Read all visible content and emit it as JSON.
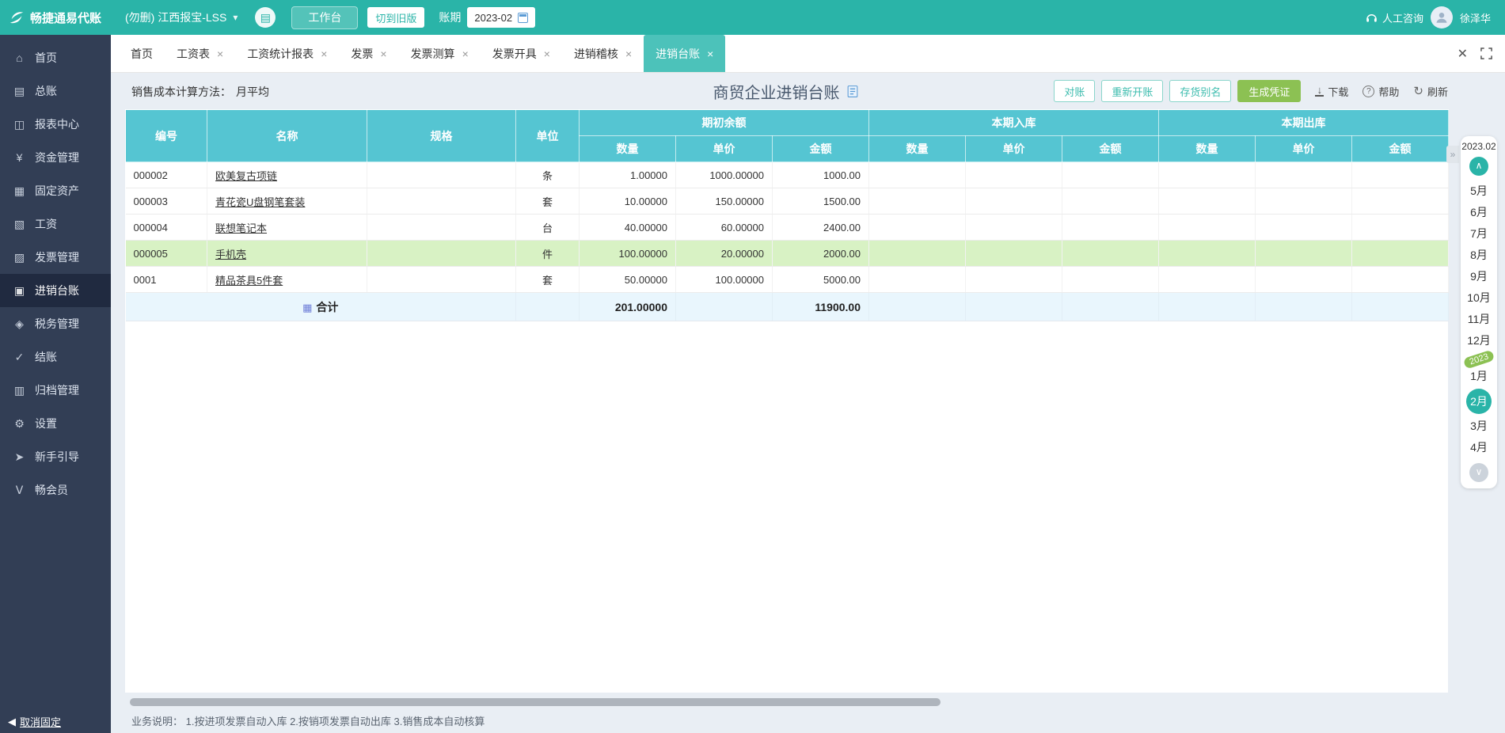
{
  "colors": {
    "topbar_teal": "#2ab4a8",
    "sidebar_navy": "#323e55",
    "sidebar_active": "#202a40",
    "tab_active_teal": "#4cc2ba",
    "table_header_cyan": "#55c5d2",
    "row_highlight_green": "#d8f2c4",
    "total_row_blue": "#e9f6fd",
    "primary_green": "#8cc153"
  },
  "topbar": {
    "logo_text": "畅捷通易代账",
    "company": "(勿删) 江西报宝-LSS",
    "workbench_button": "工作台",
    "switch_old_button": "切到旧版",
    "period_label": "账期",
    "period_value": "2023-02",
    "support_label": "人工咨询",
    "user_name": "徐泽华"
  },
  "sidebar": {
    "items": [
      {
        "label": "首页",
        "icon_glyph": "⌂"
      },
      {
        "label": "总账",
        "icon_glyph": "▤"
      },
      {
        "label": "报表中心",
        "icon_glyph": "◫"
      },
      {
        "label": "资金管理",
        "icon_glyph": "¥"
      },
      {
        "label": "固定资产",
        "icon_glyph": "▦"
      },
      {
        "label": "工资",
        "icon_glyph": "▧"
      },
      {
        "label": "发票管理",
        "icon_glyph": "▨"
      },
      {
        "label": "进销台账",
        "icon_glyph": "▣"
      },
      {
        "label": "税务管理",
        "icon_glyph": "◈"
      },
      {
        "label": "结账",
        "icon_glyph": "✓"
      },
      {
        "label": "归档管理",
        "icon_glyph": "▥"
      },
      {
        "label": "设置",
        "icon_glyph": "⚙"
      },
      {
        "label": "新手引导",
        "icon_glyph": "➤"
      },
      {
        "label": "畅会员",
        "icon_glyph": "Ⅴ"
      }
    ],
    "unpin_label": "取消固定"
  },
  "tabs": [
    {
      "label": "首页"
    },
    {
      "label": "工资表"
    },
    {
      "label": "工资统计报表"
    },
    {
      "label": "发票"
    },
    {
      "label": "发票测算"
    },
    {
      "label": "发票开具"
    },
    {
      "label": "进销稽核"
    },
    {
      "label": "进销台账"
    }
  ],
  "page": {
    "cost_method_label": "销售成本计算方法：",
    "cost_method_value": "月平均",
    "title": "商贸企业进销台账",
    "buttons": {
      "reconcile": "对账",
      "reopen": "重新开账",
      "alias": "存货别名",
      "voucher": "生成凭证"
    },
    "tools": {
      "download": "下载",
      "help": "帮助",
      "refresh": "刷新"
    }
  },
  "table": {
    "columns": [
      "编号",
      "名称",
      "规格",
      "单位"
    ],
    "groups": [
      {
        "label": "期初余额",
        "sub": [
          "数量",
          "单价",
          "金额"
        ]
      },
      {
        "label": "本期入库",
        "sub": [
          "数量",
          "单价",
          "金额"
        ]
      },
      {
        "label": "本期出库",
        "sub": [
          "数量",
          "单价",
          "金额"
        ]
      }
    ],
    "rows": [
      {
        "code": "000002",
        "name": "欧美复古项链",
        "spec": "",
        "unit": "条",
        "begin_qty": "1.00000",
        "begin_price": "1000.00000",
        "begin_amount": "1000.00"
      },
      {
        "code": "000003",
        "name": "青花瓷U盘钢笔套装",
        "spec": "",
        "unit": "套",
        "begin_qty": "10.00000",
        "begin_price": "150.00000",
        "begin_amount": "1500.00"
      },
      {
        "code": "000004",
        "name": "联想笔记本",
        "spec": "",
        "unit": "台",
        "begin_qty": "40.00000",
        "begin_price": "60.00000",
        "begin_amount": "2400.00"
      },
      {
        "code": "000005",
        "name": "手机壳",
        "spec": "",
        "unit": "件",
        "begin_qty": "100.00000",
        "begin_price": "20.00000",
        "begin_amount": "2000.00"
      },
      {
        "code": "0001",
        "name": "精品茶具5件套",
        "spec": "",
        "unit": "套",
        "begin_qty": "50.00000",
        "begin_price": "100.00000",
        "begin_amount": "5000.00"
      }
    ],
    "total": {
      "label": "合计",
      "begin_qty": "201.00000",
      "begin_amount": "11900.00"
    }
  },
  "period_panel": {
    "current": "2023.02",
    "year_badge": "2023",
    "months": [
      "5月",
      "6月",
      "7月",
      "8月",
      "9月",
      "10月",
      "11月",
      "12月",
      "1月",
      "2月",
      "3月",
      "4月"
    ],
    "active_month": "2月"
  },
  "footer": {
    "note": "业务说明： 1.按进项发票自动入库  2.按销项发票自动出库  3.销售成本自动核算"
  },
  "icons": {
    "chevron_down": "▾",
    "tab_close": "×",
    "panel_close": "✕",
    "collapse": "»",
    "up_arrow": "∧",
    "down_arrow": "∨",
    "refresh": "↻",
    "download_arrow": "↓",
    "help_mark": "?",
    "memo": "▤",
    "sum": "▦",
    "unpin_arrow": "◀"
  }
}
